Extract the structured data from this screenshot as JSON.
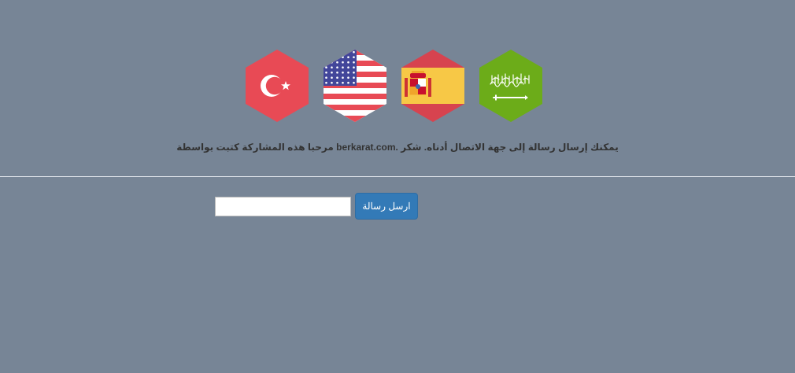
{
  "flags": [
    {
      "country": "Turkey",
      "icon": "turkey-flag-icon",
      "color": "#e84a55"
    },
    {
      "country": "United States",
      "icon": "usa-flag-icon",
      "color": "#e84a55"
    },
    {
      "country": "Spain",
      "icon": "spain-flag-icon",
      "color": "#f7c846"
    },
    {
      "country": "Saudi Arabia",
      "icon": "saudi-arabia-flag-icon",
      "color": "#6cac19"
    }
  ],
  "message": "يمكنك إرسال رسالة إلى جهة الاتصال أدناه. شكر .berkarat.com مرحبا هذه المشاركة كتبت بواسطة",
  "form": {
    "input_value": "",
    "input_placeholder": "",
    "send_label": "ارسل رسالة",
    "send_color": "#337ab7"
  },
  "background_color": "#778596"
}
